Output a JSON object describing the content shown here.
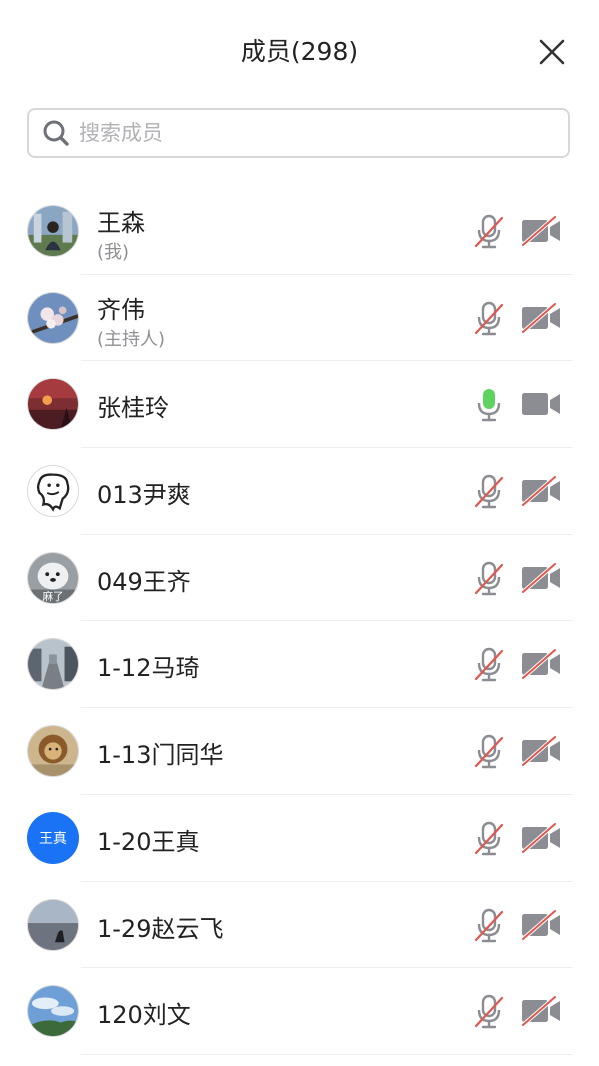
{
  "header": {
    "title": "成员(298)"
  },
  "search": {
    "placeholder": "搜索成员",
    "value": ""
  },
  "colors": {
    "mic_active": "#5fd35f",
    "muted_slash": "#e0574f",
    "icon_gray": "#8b8d93",
    "avatar_blue": "#1a73f5"
  },
  "members": [
    {
      "name": "王森",
      "role": "(我)",
      "avatar": "photo-portrait",
      "mic": "muted",
      "camera": "off"
    },
    {
      "name": "齐伟",
      "role": "(主持人)",
      "avatar": "photo-flower",
      "mic": "muted",
      "camera": "off"
    },
    {
      "name": "张桂玲",
      "role": "",
      "avatar": "photo-sunset",
      "mic": "active",
      "camera": "on"
    },
    {
      "name": "013尹爽",
      "role": "",
      "avatar": "drawing-face",
      "mic": "muted",
      "camera": "off"
    },
    {
      "name": "049王齐",
      "role": "",
      "avatar": "photo-dog",
      "avatar_text": "麻了",
      "mic": "muted",
      "camera": "off"
    },
    {
      "name": "1-12马琦",
      "role": "",
      "avatar": "photo-street",
      "mic": "muted",
      "camera": "off"
    },
    {
      "name": "1-13门同华",
      "role": "",
      "avatar": "photo-lion",
      "mic": "muted",
      "camera": "off"
    },
    {
      "name": "1-20王真",
      "role": "",
      "avatar": "initials",
      "avatar_text": "王真",
      "mic": "muted",
      "camera": "off"
    },
    {
      "name": "1-29赵云飞",
      "role": "",
      "avatar": "photo-lake",
      "mic": "muted",
      "camera": "off"
    },
    {
      "name": "120刘文",
      "role": "",
      "avatar": "photo-sky",
      "mic": "muted",
      "camera": "off"
    }
  ]
}
